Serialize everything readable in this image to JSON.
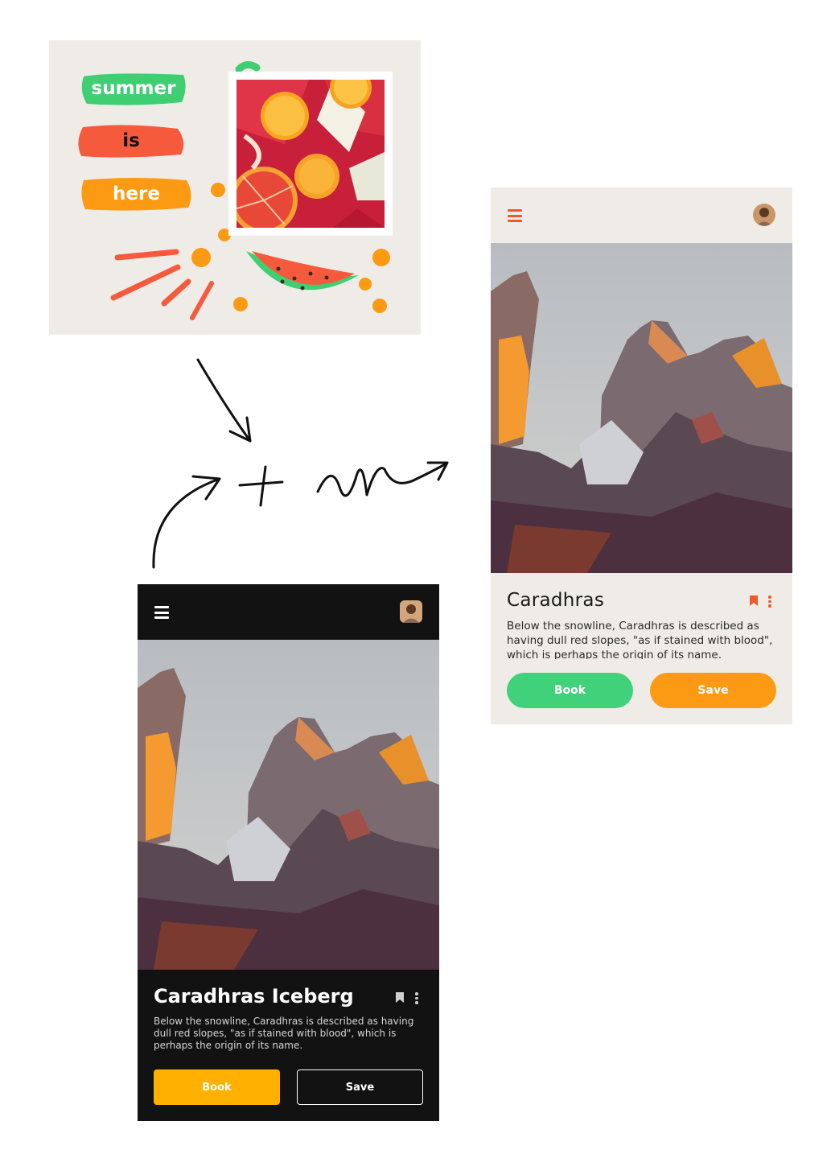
{
  "moodboard": {
    "words": [
      "summer",
      "is",
      "here"
    ],
    "colors": {
      "green": "#3fcf72",
      "red": "#f65a3c",
      "orange": "#fc9a14",
      "background": "#efece8"
    }
  },
  "light_card": {
    "title": "Caradhras",
    "description": "Below the snowline, Caradhras is described as having dull red slopes, \"as if stained with blood\", which is perhaps the origin of its name.",
    "book_label": "Book",
    "save_label": "Save",
    "menu_icon": "hamburger-icon",
    "bookmark_icon": "bookmark-icon",
    "more_icon": "more-vertical-icon",
    "colors": {
      "accent": "#ee5a2f",
      "book": "#41d17a",
      "save": "#fc9a14",
      "background": "#efece8"
    }
  },
  "dark_card": {
    "title": "Caradhras Iceberg",
    "description": "Below the snowline, Caradhras is described as having dull red slopes, \"as if stained with blood\", which is perhaps the origin of its name.",
    "book_label": "Book",
    "save_label": "Save",
    "menu_icon": "hamburger-icon",
    "bookmark_icon": "bookmark-icon",
    "more_icon": "more-vertical-icon",
    "colors": {
      "book": "#ffb000",
      "background": "#121212",
      "text": "#ffffff"
    }
  }
}
